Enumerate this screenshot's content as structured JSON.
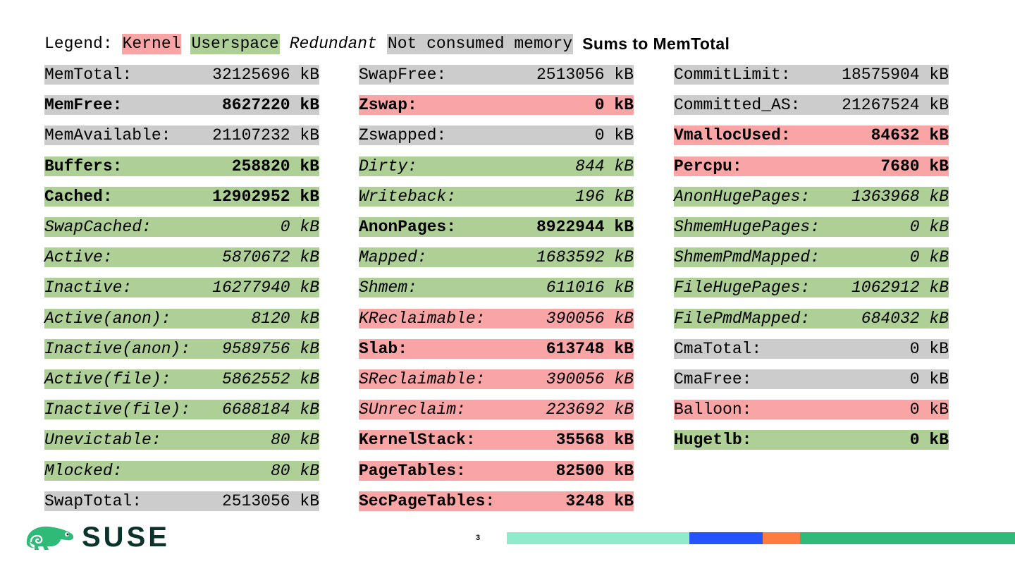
{
  "legend": {
    "prefix": "Legend:",
    "kernel": "Kernel",
    "userspace": "Userspace",
    "redundant": "Redundant",
    "not_consumed": "Not consumed memory",
    "sums": "Sums to MemTotal"
  },
  "colors": {
    "kernel": "#f9a5a5",
    "userspace": "#aed096",
    "not_consumed": "#cccccc",
    "brand_dark": "#0c322c",
    "brand_green": "#30ba78"
  },
  "columns": [
    [
      {
        "label": "MemTotal:",
        "value": "32125696 kB",
        "kind": "n",
        "bold": false,
        "italic": false
      },
      {
        "label": "MemFree:",
        "value": "8627220 kB",
        "kind": "n",
        "bold": true,
        "italic": false
      },
      {
        "label": "MemAvailable:",
        "value": "21107232 kB",
        "kind": "n",
        "bold": false,
        "italic": false
      },
      {
        "label": "Buffers:",
        "value": "258820 kB",
        "kind": "u",
        "bold": true,
        "italic": false
      },
      {
        "label": "Cached:",
        "value": "12902952 kB",
        "kind": "u",
        "bold": true,
        "italic": false
      },
      {
        "label": "SwapCached:",
        "value": "0 kB",
        "kind": "u",
        "bold": false,
        "italic": true
      },
      {
        "label": "Active:",
        "value": "5870672 kB",
        "kind": "u",
        "bold": false,
        "italic": true
      },
      {
        "label": "Inactive:",
        "value": "16277940 kB",
        "kind": "u",
        "bold": false,
        "italic": true
      },
      {
        "label": "Active(anon):",
        "value": "8120 kB",
        "kind": "u",
        "bold": false,
        "italic": true
      },
      {
        "label": "Inactive(anon):",
        "value": "9589756 kB",
        "kind": "u",
        "bold": false,
        "italic": true
      },
      {
        "label": "Active(file):",
        "value": "5862552 kB",
        "kind": "u",
        "bold": false,
        "italic": true
      },
      {
        "label": "Inactive(file):",
        "value": "6688184 kB",
        "kind": "u",
        "bold": false,
        "italic": true
      },
      {
        "label": "Unevictable:",
        "value": "80 kB",
        "kind": "u",
        "bold": false,
        "italic": true
      },
      {
        "label": "Mlocked:",
        "value": "80 kB",
        "kind": "u",
        "bold": false,
        "italic": true
      },
      {
        "label": "SwapTotal:",
        "value": "2513056 kB",
        "kind": "n",
        "bold": false,
        "italic": false
      }
    ],
    [
      {
        "label": "SwapFree:",
        "value": "2513056 kB",
        "kind": "n",
        "bold": false,
        "italic": false
      },
      {
        "label": "Zswap:",
        "value": "0 kB",
        "kind": "k",
        "bold": true,
        "italic": false
      },
      {
        "label": "Zswapped:",
        "value": "0 kB",
        "kind": "n",
        "bold": false,
        "italic": false
      },
      {
        "label": "Dirty:",
        "value": "844 kB",
        "kind": "u",
        "bold": false,
        "italic": true
      },
      {
        "label": "Writeback:",
        "value": "196 kB",
        "kind": "u",
        "bold": false,
        "italic": true
      },
      {
        "label": "AnonPages:",
        "value": "8922944 kB",
        "kind": "u",
        "bold": true,
        "italic": false
      },
      {
        "label": "Mapped:",
        "value": "1683592 kB",
        "kind": "u",
        "bold": false,
        "italic": true
      },
      {
        "label": "Shmem:",
        "value": "611016 kB",
        "kind": "u",
        "bold": false,
        "italic": true
      },
      {
        "label": "KReclaimable:",
        "value": "390056 kB",
        "kind": "k",
        "bold": false,
        "italic": true
      },
      {
        "label": "Slab:",
        "value": "613748 kB",
        "kind": "k",
        "bold": true,
        "italic": false
      },
      {
        "label": "SReclaimable:",
        "value": "390056 kB",
        "kind": "k",
        "bold": false,
        "italic": true
      },
      {
        "label": "SUnreclaim:",
        "value": "223692 kB",
        "kind": "k",
        "bold": false,
        "italic": true
      },
      {
        "label": "KernelStack:",
        "value": "35568 kB",
        "kind": "k",
        "bold": true,
        "italic": false
      },
      {
        "label": "PageTables:",
        "value": "82500 kB",
        "kind": "k",
        "bold": true,
        "italic": false
      },
      {
        "label": "SecPageTables:",
        "value": "3248 kB",
        "kind": "k",
        "bold": true,
        "italic": false
      }
    ],
    [
      {
        "label": "CommitLimit:",
        "value": "18575904 kB",
        "kind": "n",
        "bold": false,
        "italic": false
      },
      {
        "label": "Committed_AS:",
        "value": "21267524 kB",
        "kind": "n",
        "bold": false,
        "italic": false
      },
      {
        "label": "VmallocUsed:",
        "value": "84632 kB",
        "kind": "k",
        "bold": true,
        "italic": false
      },
      {
        "label": "Percpu:",
        "value": "7680 kB",
        "kind": "k",
        "bold": true,
        "italic": false
      },
      {
        "label": "AnonHugePages:",
        "value": "1363968 kB",
        "kind": "u",
        "bold": false,
        "italic": true
      },
      {
        "label": "ShmemHugePages:",
        "value": "0 kB",
        "kind": "u",
        "bold": false,
        "italic": true
      },
      {
        "label": "ShmemPmdMapped:",
        "value": "0 kB",
        "kind": "u",
        "bold": false,
        "italic": true
      },
      {
        "label": "FileHugePages:",
        "value": "1062912 kB",
        "kind": "u",
        "bold": false,
        "italic": true
      },
      {
        "label": "FilePmdMapped:",
        "value": "684032 kB",
        "kind": "u",
        "bold": false,
        "italic": true
      },
      {
        "label": "CmaTotal:",
        "value": "0 kB",
        "kind": "n",
        "bold": false,
        "italic": false
      },
      {
        "label": "CmaFree:",
        "value": "0 kB",
        "kind": "n",
        "bold": false,
        "italic": false
      },
      {
        "label": "Balloon:",
        "value": "0 kB",
        "kind": "k",
        "bold": false,
        "italic": false
      },
      {
        "label": "Hugetlb:",
        "value": "0 kB",
        "kind": "u",
        "bold": true,
        "italic": false
      }
    ]
  ],
  "footer": {
    "logo_text": "SUSE",
    "logo_icon": "chameleon-icon",
    "page_number": "3",
    "bar_colors": [
      "#90ebcd",
      "#2453ff",
      "#fe7c3f",
      "#30ba78"
    ]
  }
}
